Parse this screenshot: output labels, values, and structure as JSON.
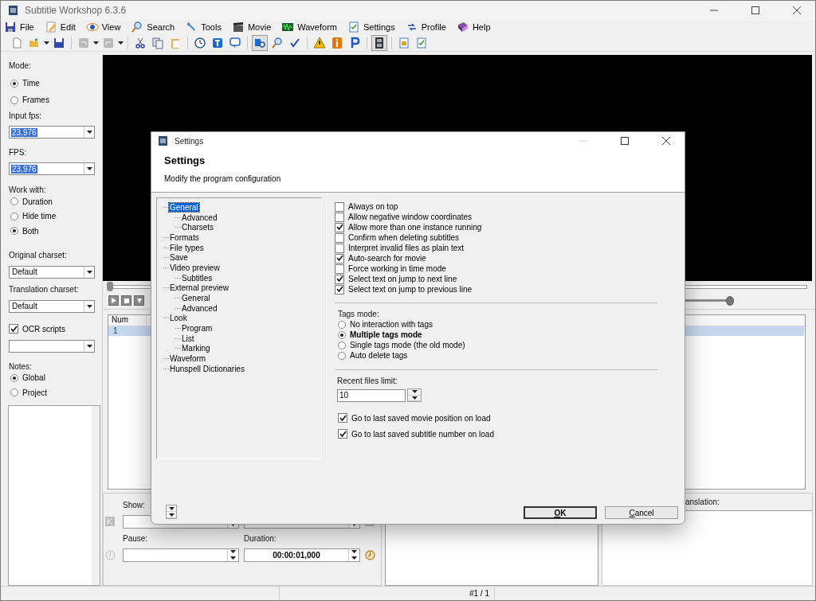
{
  "window": {
    "title": "Subtitle Workshop 6.3.6"
  },
  "menu": [
    {
      "label": "File"
    },
    {
      "label": "Edit"
    },
    {
      "label": "View"
    },
    {
      "label": "Search"
    },
    {
      "label": "Tools"
    },
    {
      "label": "Movie"
    },
    {
      "label": "Waveform"
    },
    {
      "label": "Settings"
    },
    {
      "label": "Profile"
    },
    {
      "label": "Help"
    }
  ],
  "toolbar": [
    {
      "pressed": false,
      "disabled": false
    },
    {
      "pressed": false,
      "disabled": false
    },
    {
      "pressed": false,
      "disabled": false
    },
    {
      "pressed": false,
      "disabled": true
    },
    {
      "pressed": false,
      "disabled": true
    },
    {
      "pressed": false,
      "disabled": false
    },
    {
      "pressed": false,
      "disabled": false
    },
    {
      "pressed": false,
      "disabled": false
    },
    {
      "pressed": false,
      "disabled": false
    },
    {
      "pressed": false,
      "disabled": false
    },
    {
      "pressed": false,
      "disabled": false
    },
    {
      "pressed": true,
      "disabled": false
    },
    {
      "pressed": false,
      "disabled": false
    },
    {
      "pressed": false,
      "disabled": false
    },
    {
      "pressed": false,
      "disabled": false
    },
    {
      "pressed": false,
      "disabled": false
    },
    {
      "pressed": false,
      "disabled": false
    },
    {
      "pressed": true,
      "disabled": false
    },
    {
      "pressed": false,
      "disabled": false
    },
    {
      "pressed": false,
      "disabled": false
    }
  ],
  "side_panel": {
    "mode": {
      "label": "Mode:",
      "options": [
        {
          "label": "Time",
          "selected": true
        },
        {
          "label": "Frames",
          "selected": false
        }
      ]
    },
    "input_fps": {
      "label": "Input fps:",
      "value": "23,976"
    },
    "fps": {
      "label": "FPS:",
      "value": "23,976"
    },
    "work_with": {
      "label": "Work with:",
      "options": [
        {
          "label": "Duration",
          "selected": false
        },
        {
          "label": "Hide time",
          "selected": false
        },
        {
          "label": "Both",
          "selected": true
        }
      ]
    },
    "original_charset": {
      "label": "Original charset:",
      "value": "Default"
    },
    "translation_charset": {
      "label": "Translation charset:",
      "value": "Default"
    },
    "ocr_scripts": {
      "label": "OCR scripts",
      "checked": true
    },
    "notes": {
      "label": "Notes:",
      "options": [
        {
          "label": "Global",
          "selected": true
        },
        {
          "label": "Project",
          "selected": false
        }
      ]
    }
  },
  "player": {
    "seek": {
      "level": 0
    },
    "volume": {
      "level": 1
    }
  },
  "subtitle_list": {
    "columns": [
      "Num"
    ],
    "rows": [
      {
        "num": "1",
        "selected": true
      }
    ]
  },
  "editor": {
    "show_label": "Show:",
    "pause_label": "Pause:",
    "duration_label": "Duration:",
    "duration_value": "00:00:01,000",
    "translation_label": "anslation:"
  },
  "status_bar": {
    "position": "#1 / 1"
  },
  "dialog": {
    "title": "Settings",
    "heading": "Settings",
    "subtitle": "Modify the program configuration",
    "tree": [
      {
        "label": "General",
        "selected": true,
        "children": [
          {
            "label": "Advanced",
            "selected": false
          },
          {
            "label": "Charsets",
            "selected": false
          }
        ]
      },
      {
        "label": "Formats",
        "selected": false
      },
      {
        "label": "File types",
        "selected": false
      },
      {
        "label": "Save",
        "selected": false
      },
      {
        "label": "Video preview",
        "selected": false,
        "children": [
          {
            "label": "Subtitles",
            "selected": false
          }
        ]
      },
      {
        "label": "External preview",
        "selected": false,
        "children": [
          {
            "label": "General",
            "selected": false
          },
          {
            "label": "Advanced",
            "selected": false
          }
        ]
      },
      {
        "label": "Look",
        "selected": false,
        "children": [
          {
            "label": "Program",
            "selected": false
          },
          {
            "label": "List",
            "selected": false
          },
          {
            "label": "Marking",
            "selected": false
          }
        ]
      },
      {
        "label": "Waveform",
        "selected": false
      },
      {
        "label": "Hunspell Dictionaries",
        "selected": false
      }
    ],
    "options": [
      {
        "label": "Always on top",
        "checked": false
      },
      {
        "label": "Allow negative window coordinates",
        "checked": false
      },
      {
        "label": "Allow more than one instance running",
        "checked": true
      },
      {
        "label": "Confirm when deleting subtitles",
        "checked": false
      },
      {
        "label": "Interpret invalid files as plain text",
        "checked": false
      },
      {
        "label": "Auto-search for movie",
        "checked": true
      },
      {
        "label": "Force working in time mode",
        "checked": false
      },
      {
        "label": "Select text on jump to next line",
        "checked": true
      },
      {
        "label": "Select text on jump to previous line",
        "checked": true
      }
    ],
    "tags_mode": {
      "label": "Tags mode:",
      "options": [
        {
          "label": "No interaction with tags",
          "selected": false
        },
        {
          "label": "Multiple tags mode",
          "selected": true
        },
        {
          "label": "Single tags mode (the old mode)",
          "selected": false
        },
        {
          "label": "Auto delete tags",
          "selected": false
        }
      ]
    },
    "recent_files": {
      "label": "Recent files limit:",
      "value": "10"
    },
    "load_options": [
      {
        "label": "Go to last saved movie position on load",
        "checked": true
      },
      {
        "label": "Go to last saved subtitle number on load",
        "checked": true
      }
    ],
    "buttons": [
      {
        "label": "OK",
        "default": true
      },
      {
        "label": "Cancel",
        "default": false
      }
    ]
  }
}
